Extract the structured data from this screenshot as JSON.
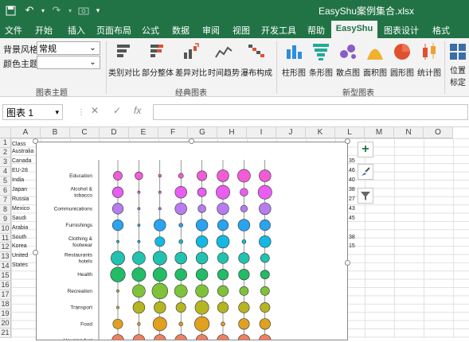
{
  "titlebar": {
    "title": "EasyShu案例集合.xlsx"
  },
  "tabs": [
    {
      "label": "文件"
    },
    {
      "label": "开始"
    },
    {
      "label": "插入"
    },
    {
      "label": "页面布局"
    },
    {
      "label": "公式"
    },
    {
      "label": "数据"
    },
    {
      "label": "审阅"
    },
    {
      "label": "视图"
    },
    {
      "label": "开发工具"
    },
    {
      "label": "帮助"
    },
    {
      "label": "EasyShu"
    },
    {
      "label": "图表设计"
    },
    {
      "label": "格式"
    }
  ],
  "ribbon": {
    "theme": {
      "bg_label": "背景风格",
      "bg_value": "常规",
      "color_label": "颜色主题",
      "color_value": "",
      "group_label": "图表主题"
    },
    "classic": {
      "group_label": "经典图表",
      "buttons": [
        "类别对比",
        "部分整体",
        "差异对比",
        "时间趋势",
        "瀑布构成"
      ]
    },
    "new": {
      "group_label": "新型图表",
      "buttons": [
        "柱形图",
        "条形图",
        "散点图",
        "面积图",
        "圆形图",
        "统计图"
      ]
    },
    "position": {
      "label_line1": "位置",
      "label_line2": "标定"
    }
  },
  "formula": {
    "namebox": "图表 1",
    "cancel": "✕",
    "confirm": "✓",
    "fx": "fx",
    "value": ""
  },
  "columns": [
    "A",
    "B",
    "C",
    "D",
    "E",
    "F",
    "G",
    "H",
    "I",
    "J",
    "K",
    "L",
    "M",
    "N",
    "O"
  ],
  "rows": [
    "1",
    "2",
    "3",
    "4",
    "5",
    "6",
    "7",
    "8",
    "9",
    "10",
    "11",
    "12",
    "13",
    "14",
    "15",
    "16",
    "17",
    "18",
    "19",
    "20",
    "21"
  ],
  "cells": {
    "a1": "Class",
    "a_col": [
      "Australia",
      "Canada",
      "EU-28",
      "India",
      "Japan",
      "Russia",
      "Mexico",
      "Saudi",
      "Arabia",
      "South",
      "Korea",
      "United",
      "States"
    ],
    "l_col": [
      "35",
      "46",
      "40",
      "38",
      "27",
      "43",
      "45",
      "",
      "38",
      "15"
    ]
  },
  "chart_data": {
    "type": "bubble-grid",
    "categories": [
      "Education",
      "Alcohol & tobacco",
      "Communications",
      "Furnishings",
      "Clothing & footwear",
      "Restaurants hotels",
      "Health",
      "Recreation",
      "Transport",
      "Food",
      "Housing,fuel"
    ],
    "colors": [
      "#f25cd6",
      "#e85ef0",
      "#b77cf0",
      "#2aa3f0",
      "#15b8e0",
      "#22c2b0",
      "#22bb66",
      "#7fc23a",
      "#b5b522",
      "#e0a020",
      "#f08060"
    ],
    "series_count": 8,
    "values": [
      [
        0.45,
        0.4,
        0.15,
        0.25,
        0.5,
        0.6,
        0.65,
        0.6
      ],
      [
        0.55,
        0.1,
        0.1,
        0.6,
        0.45,
        0.7,
        0.4,
        0.7
      ],
      [
        0.55,
        0.1,
        0.1,
        0.6,
        0.4,
        0.6,
        0.35,
        0.6
      ],
      [
        0.55,
        0.1,
        0.6,
        0.2,
        0.6,
        0.55,
        0.6,
        0.55
      ],
      [
        0.1,
        0.1,
        0.5,
        0.2,
        0.6,
        0.65,
        0.2,
        0.6
      ],
      [
        0.7,
        0.65,
        0.7,
        0.6,
        0.6,
        0.55,
        0.55,
        0.45
      ],
      [
        0.75,
        0.7,
        0.7,
        0.6,
        0.6,
        0.55,
        0.55,
        0.45
      ],
      [
        0.1,
        0.65,
        0.8,
        0.65,
        0.65,
        0.55,
        0.45,
        0.45
      ],
      [
        0.1,
        0.6,
        0.6,
        0.5,
        0.7,
        0.55,
        0.55,
        0.5
      ],
      [
        0.5,
        0.15,
        0.7,
        0.2,
        0.75,
        0.2,
        0.55,
        0.55
      ],
      [
        0.6,
        0.6,
        0.6,
        0.6,
        0.6,
        0.6,
        0.6,
        0.6
      ]
    ]
  }
}
